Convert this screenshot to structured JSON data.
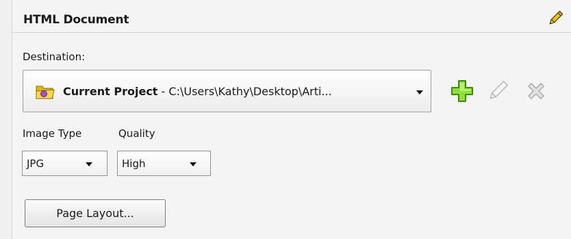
{
  "panel": {
    "title": "HTML Document",
    "edit_icon": "pencil-icon"
  },
  "destination": {
    "label": "Destination:",
    "project_name": "Current Project",
    "separator": " - ",
    "path": "C:\\Users\\Kathy\\Desktop\\Arti...",
    "folder_icon": "folder-icon",
    "actions": [
      {
        "name": "add-destination-button",
        "icon": "plus-icon",
        "color": "#63c80e"
      },
      {
        "name": "edit-destination-button",
        "icon": "pencil-icon",
        "color": "#c8c8c8"
      },
      {
        "name": "delete-destination-button",
        "icon": "close-icon",
        "color": "#c8c8c8"
      }
    ]
  },
  "image_type": {
    "label": "Image Type",
    "value": "JPG"
  },
  "quality": {
    "label": "Quality",
    "value": "High"
  },
  "page_layout_button": "Page Layout..."
}
